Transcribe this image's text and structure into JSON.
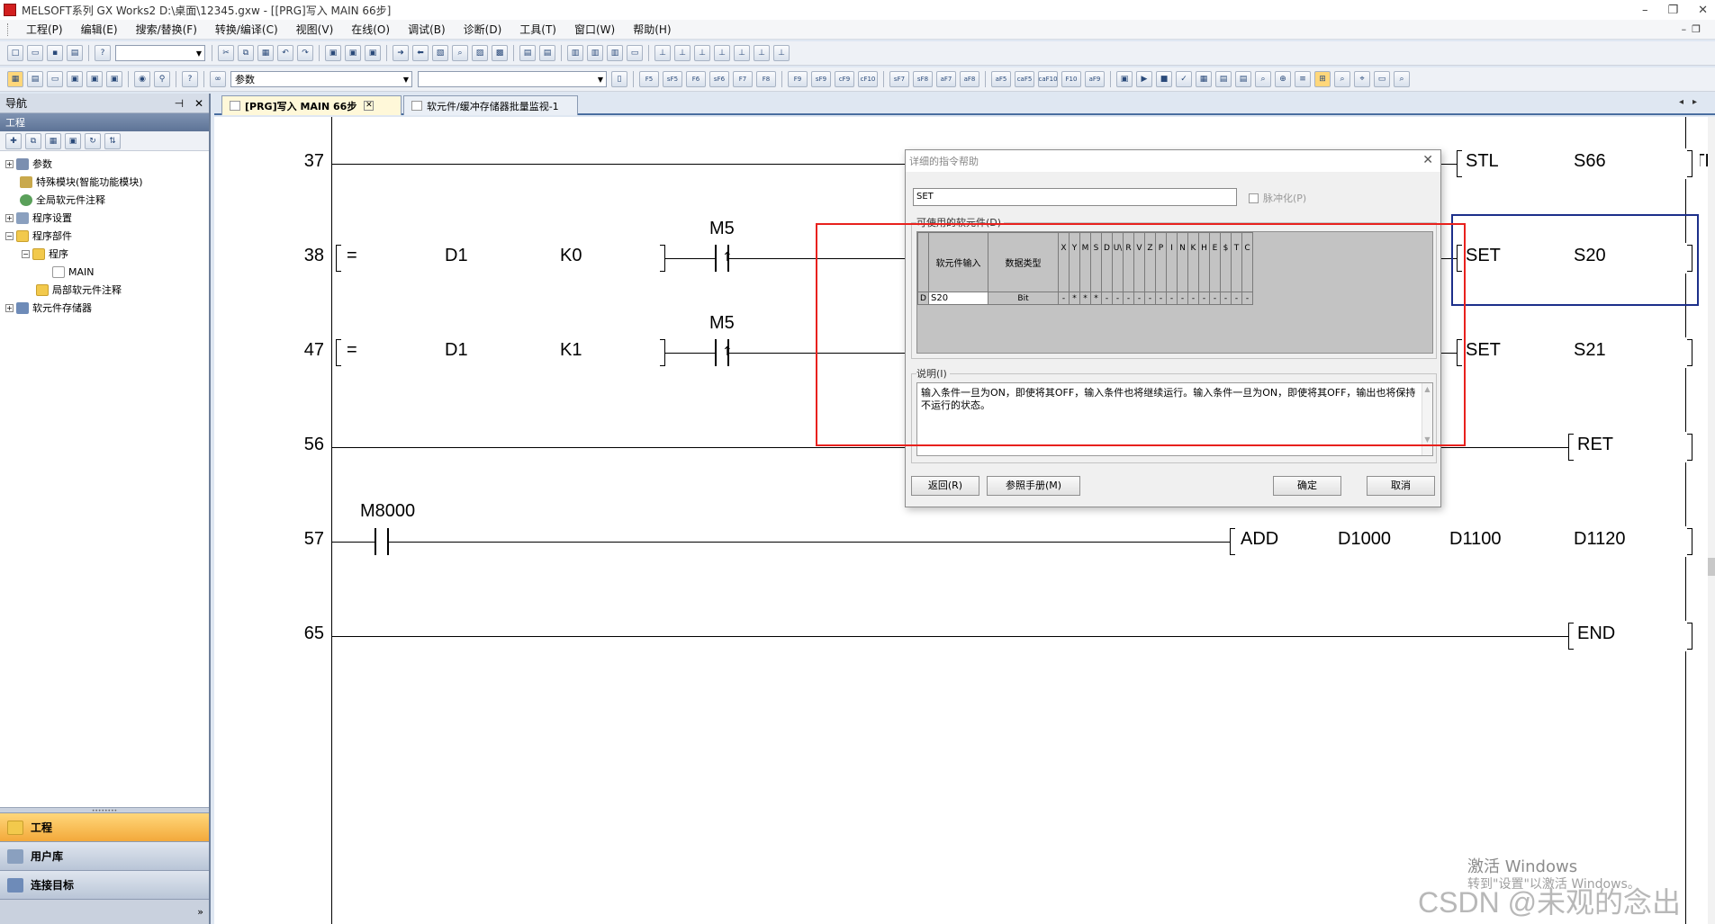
{
  "window": {
    "title": "MELSOFT系列 GX Works2 D:\\桌面\\12345.gxw - [[PRG]写入 MAIN 66步]",
    "controls": [
      "–",
      "❐",
      "✕"
    ]
  },
  "menu": [
    "工程(P)",
    "编辑(E)",
    "搜索/替换(F)",
    "转换/编译(C)",
    "视图(V)",
    "在线(O)",
    "调试(B)",
    "诊断(D)",
    "工具(T)",
    "窗口(W)",
    "帮助(H)"
  ],
  "toolbar2": {
    "combo_value": "参数",
    "fkeys": [
      "F5",
      "sF5",
      "F6",
      "sF6",
      "F7",
      "F8",
      "F9",
      "sF9",
      "cF9",
      "cF10",
      "sF7",
      "sF8",
      "aF7",
      "aF8",
      "aF5",
      "caF5",
      "caF10",
      "F10",
      "aF9"
    ]
  },
  "nav": {
    "title": "导航",
    "pin": "⊣",
    "close": "✕",
    "section": "工程",
    "tree": [
      {
        "label": "参数",
        "indent": 0,
        "exp": "+",
        "icon": "param"
      },
      {
        "label": "特殊模块(智能功能模块)",
        "indent": 1,
        "exp": "",
        "icon": "mod"
      },
      {
        "label": "全局软元件注释",
        "indent": 1,
        "exp": "",
        "icon": "glob"
      },
      {
        "label": "程序设置",
        "indent": 0,
        "exp": "+",
        "icon": "set"
      },
      {
        "label": "程序部件",
        "indent": 0,
        "exp": "−",
        "icon": "folder"
      },
      {
        "label": "程序",
        "indent": 1,
        "exp": "−",
        "icon": "folder"
      },
      {
        "label": "MAIN",
        "indent": 2,
        "exp": "",
        "icon": "prog"
      },
      {
        "label": "局部软元件注释",
        "indent": 2,
        "exp": "",
        "icon": "folder"
      },
      {
        "label": "软元件存储器",
        "indent": 0,
        "exp": "+",
        "icon": "dev"
      }
    ],
    "tabs": [
      "工程",
      "用户库",
      "连接目标"
    ]
  },
  "tabs": {
    "tab1": "[PRG]写入 MAIN 66步",
    "tab2": "软元件/缓冲存储器批量监视-1"
  },
  "ladder": {
    "rungs": [
      {
        "step": "37"
      },
      {
        "step": "38",
        "cmp": "=",
        "op1": "D1",
        "op2": "K0",
        "contact": "M5",
        "inst": "SET",
        "dev": "S20"
      },
      {
        "step": "47",
        "cmp": "=",
        "op1": "D1",
        "op2": "K1",
        "contact": "M5",
        "inst": "SET",
        "dev": "S21"
      },
      {
        "step": "56",
        "inst": "RET"
      },
      {
        "step": "57",
        "contact": "M8000",
        "inst": "ADD",
        "a": "D1000",
        "b": "D1100",
        "c": "D1120"
      },
      {
        "step": "65",
        "inst": "END"
      }
    ],
    "stl": {
      "inst": "STL",
      "dev": "S66"
    }
  },
  "dialog": {
    "title": "详细的指令帮助",
    "instruction": "SET",
    "pulse_label": "脉冲化(P)",
    "usable_label": "可使用的软元件(D)",
    "col_input": "软元件输入",
    "col_type": "数据类型",
    "letters": [
      "X",
      "Y",
      "M",
      "S",
      "D",
      "U\\",
      "R",
      "V",
      "Z",
      "P",
      "I",
      "N",
      "K",
      "H",
      "E",
      "$",
      "T",
      "C"
    ],
    "row": {
      "prefix": "D",
      "input": "S20",
      "type": "Bit",
      "flags": [
        "-",
        "*",
        "*",
        "*",
        "-",
        "-",
        "-",
        "-",
        "-",
        "-",
        "-",
        "-",
        "-",
        "-",
        "-",
        "-",
        "-",
        "-"
      ]
    },
    "desc_label": "说明(I)",
    "desc_text": "输入条件一旦为ON，即使将其OFF，输入条件也将继续运行。输入条件一旦为ON，即使将其OFF，输出也将保持不运行的状态。",
    "buttons": {
      "back": "返回(R)",
      "manual": "参照手册(M)",
      "ok": "确定",
      "cancel": "取消"
    }
  },
  "watermark": {
    "line1": "激活 Windows",
    "line2": "转到\"设置\"以激活 Windows。",
    "csdn": "CSDN @未观的念出"
  },
  "colors": {
    "highlight": "#e8211d",
    "selection": "#1c2f8a",
    "active_tab": "#f3a93b"
  }
}
